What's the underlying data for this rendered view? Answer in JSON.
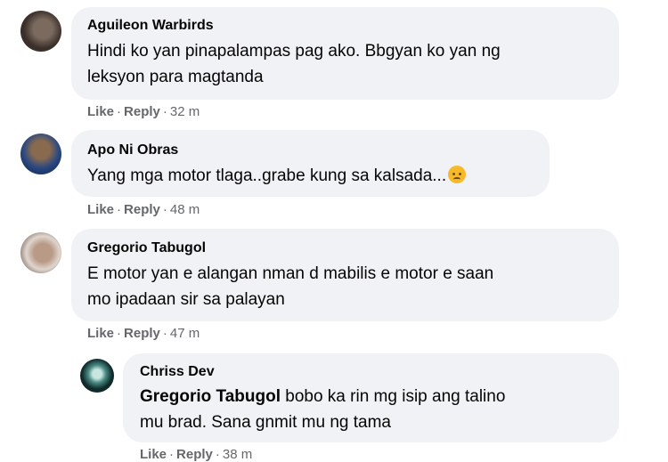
{
  "comments": [
    {
      "author": "Aguileon Warbirds",
      "line1": "Hindi ko yan pinapalampas pag ako. Bbgyan ko yan ng",
      "line2": "leksyon para magtanda",
      "like": "Like",
      "reply": "Reply",
      "time": "32 m",
      "avatar_colors": [
        "#3a2f2a",
        "#7b6a5e"
      ]
    },
    {
      "author": "Apo Ni Obras",
      "line1": "Yang mga motor tlaga..grabe kung sa kalsada...",
      "emoji": "pensive-face",
      "like": "Like",
      "reply": "Reply",
      "time": "48 m",
      "avatar_colors": [
        "#5b4530",
        "#1f3b6e"
      ]
    },
    {
      "author": "Gregorio Tabugol",
      "line1": "E motor yan e alangan nman d mabilis e motor e saan",
      "line2": "mo ipadaan sir sa palayan",
      "like": "Like",
      "reply": "Reply",
      "time": "47 m",
      "avatar_colors": [
        "#c9b7a8",
        "#7d6b60"
      ]
    },
    {
      "author": "Chriss Dev",
      "mention": "Gregorio Tabugol",
      "line1": "bobo ka rin mg isip ang talino",
      "line2": "mu brad. Sana gnmit mu ng tama",
      "like": "Like",
      "reply": "Reply",
      "time": "38 m",
      "avatar_colors": [
        "#0f2a2a",
        "#c8e6e0"
      ]
    }
  ],
  "separator": "·"
}
